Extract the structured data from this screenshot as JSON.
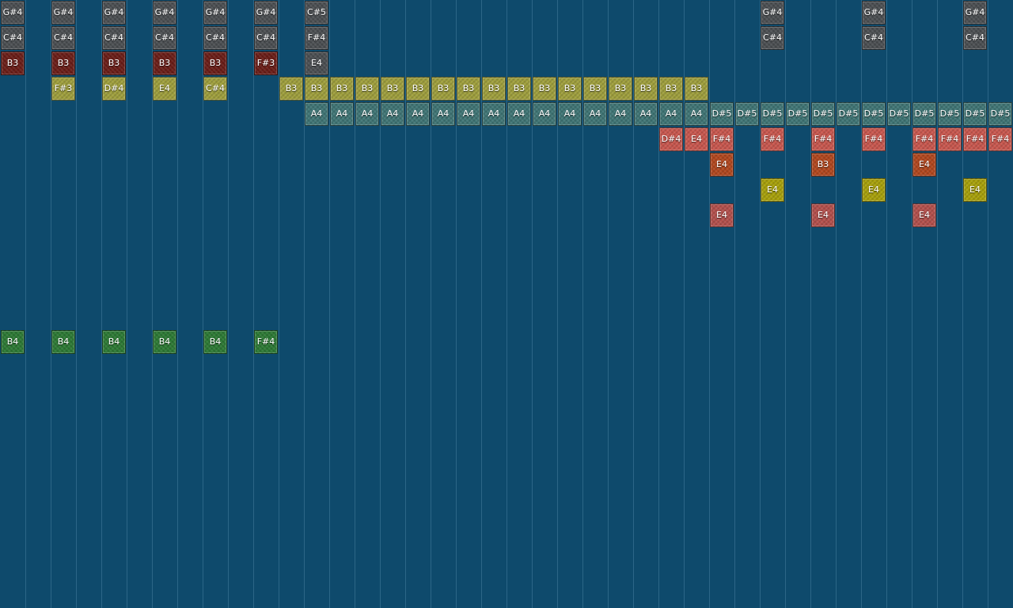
{
  "colors": {
    "background": "#0e4a6c",
    "grid_line": "#2c6687",
    "gray": "#4b4f52",
    "maroon": "#6b1d17",
    "olive": "#9f9f3c",
    "teal": "#3f7575",
    "salmon": "#c9574e",
    "rust": "#b2471e",
    "yellow": "#a8a10a",
    "rose": "#b4504c",
    "green": "#2c7a34"
  },
  "tracks": [
    {
      "color": "gray",
      "notes": [
        {
          "col": 0,
          "label": "G#4"
        },
        {
          "col": 2,
          "label": "G#4"
        },
        {
          "col": 4,
          "label": "G#4"
        },
        {
          "col": 6,
          "label": "G#4"
        },
        {
          "col": 8,
          "label": "G#4"
        },
        {
          "col": 10,
          "label": "G#4"
        },
        {
          "col": 12,
          "label": "C#5"
        },
        {
          "col": 30,
          "label": "G#4"
        },
        {
          "col": 34,
          "label": "G#4"
        },
        {
          "col": 38,
          "label": "G#4"
        }
      ]
    },
    {
      "color": "gray",
      "notes": [
        {
          "col": 0,
          "label": "C#4"
        },
        {
          "col": 2,
          "label": "C#4"
        },
        {
          "col": 4,
          "label": "C#4"
        },
        {
          "col": 6,
          "label": "C#4"
        },
        {
          "col": 8,
          "label": "C#4"
        },
        {
          "col": 10,
          "label": "C#4"
        },
        {
          "col": 12,
          "label": "F#4"
        },
        {
          "col": 30,
          "label": "C#4"
        },
        {
          "col": 34,
          "label": "C#4"
        },
        {
          "col": 38,
          "label": "C#4"
        }
      ]
    },
    {
      "color": "maroon",
      "notes": [
        {
          "col": 0,
          "label": "B3"
        },
        {
          "col": 2,
          "label": "B3"
        },
        {
          "col": 4,
          "label": "B3"
        },
        {
          "col": 6,
          "label": "B3"
        },
        {
          "col": 8,
          "label": "B3"
        },
        {
          "col": 10,
          "label": "F#3"
        },
        {
          "col": 12,
          "label": "E4",
          "color": "gray"
        }
      ]
    },
    {
      "color": "olive",
      "notes": [
        {
          "col": 2,
          "label": "F#3"
        },
        {
          "col": 4,
          "label": "D#4"
        },
        {
          "col": 6,
          "label": "E4"
        },
        {
          "col": 8,
          "label": "C#4"
        },
        {
          "col": 11,
          "label": "B3"
        },
        {
          "col": 12,
          "label": "B3"
        },
        {
          "col": 13,
          "label": "B3"
        },
        {
          "col": 14,
          "label": "B3"
        },
        {
          "col": 15,
          "label": "B3"
        },
        {
          "col": 16,
          "label": "B3"
        },
        {
          "col": 17,
          "label": "B3"
        },
        {
          "col": 18,
          "label": "B3"
        },
        {
          "col": 19,
          "label": "B3"
        },
        {
          "col": 20,
          "label": "B3"
        },
        {
          "col": 21,
          "label": "B3"
        },
        {
          "col": 22,
          "label": "B3"
        },
        {
          "col": 23,
          "label": "B3"
        },
        {
          "col": 24,
          "label": "B3"
        },
        {
          "col": 25,
          "label": "B3"
        },
        {
          "col": 26,
          "label": "B3"
        },
        {
          "col": 27,
          "label": "B3"
        }
      ]
    },
    {
      "color": "teal",
      "notes": [
        {
          "col": 12,
          "label": "A4"
        },
        {
          "col": 13,
          "label": "A4"
        },
        {
          "col": 14,
          "label": "A4"
        },
        {
          "col": 15,
          "label": "A4"
        },
        {
          "col": 16,
          "label": "A4"
        },
        {
          "col": 17,
          "label": "A4"
        },
        {
          "col": 18,
          "label": "A4"
        },
        {
          "col": 19,
          "label": "A4"
        },
        {
          "col": 20,
          "label": "A4"
        },
        {
          "col": 21,
          "label": "A4"
        },
        {
          "col": 22,
          "label": "A4"
        },
        {
          "col": 23,
          "label": "A4"
        },
        {
          "col": 24,
          "label": "A4"
        },
        {
          "col": 25,
          "label": "A4"
        },
        {
          "col": 26,
          "label": "A4"
        },
        {
          "col": 27,
          "label": "A4"
        },
        {
          "col": 28,
          "label": "D#5"
        },
        {
          "col": 29,
          "label": "D#5"
        },
        {
          "col": 30,
          "label": "D#5"
        },
        {
          "col": 31,
          "label": "D#5"
        },
        {
          "col": 32,
          "label": "D#5"
        },
        {
          "col": 33,
          "label": "D#5"
        },
        {
          "col": 34,
          "label": "D#5"
        },
        {
          "col": 35,
          "label": "D#5"
        },
        {
          "col": 36,
          "label": "D#5"
        },
        {
          "col": 37,
          "label": "D#5"
        },
        {
          "col": 38,
          "label": "D#5"
        },
        {
          "col": 39,
          "label": "D#5"
        }
      ]
    },
    {
      "color": "salmon",
      "notes": [
        {
          "col": 26,
          "label": "D#4"
        },
        {
          "col": 27,
          "label": "E4"
        },
        {
          "col": 28,
          "label": "F#4"
        },
        {
          "col": 30,
          "label": "F#4"
        },
        {
          "col": 32,
          "label": "F#4"
        },
        {
          "col": 34,
          "label": "F#4"
        },
        {
          "col": 36,
          "label": "F#4"
        },
        {
          "col": 37,
          "label": "F#4"
        },
        {
          "col": 38,
          "label": "F#4"
        },
        {
          "col": 39,
          "label": "F#4"
        }
      ]
    },
    {
      "color": "rust",
      "notes": [
        {
          "col": 28,
          "label": "E4"
        },
        {
          "col": 32,
          "label": "B3"
        },
        {
          "col": 36,
          "label": "E4"
        }
      ]
    },
    {
      "color": "yellow",
      "notes": [
        {
          "col": 30,
          "label": "E4"
        },
        {
          "col": 34,
          "label": "E4"
        },
        {
          "col": 38,
          "label": "E4"
        }
      ]
    },
    {
      "color": "rose",
      "notes": [
        {
          "col": 28,
          "label": "E4"
        },
        {
          "col": 32,
          "label": "E4"
        },
        {
          "col": 36,
          "label": "E4"
        }
      ]
    },
    {
      "color": "green",
      "notes": []
    },
    {
      "color": "green",
      "notes": []
    },
    {
      "color": "green",
      "notes": []
    },
    {
      "color": "green",
      "notes": []
    },
    {
      "color": "green",
      "notes": [
        {
          "col": 0,
          "label": "B4"
        },
        {
          "col": 2,
          "label": "B4"
        },
        {
          "col": 4,
          "label": "B4"
        },
        {
          "col": 6,
          "label": "B4"
        },
        {
          "col": 8,
          "label": "B4"
        },
        {
          "col": 10,
          "label": "F#4"
        }
      ]
    }
  ]
}
